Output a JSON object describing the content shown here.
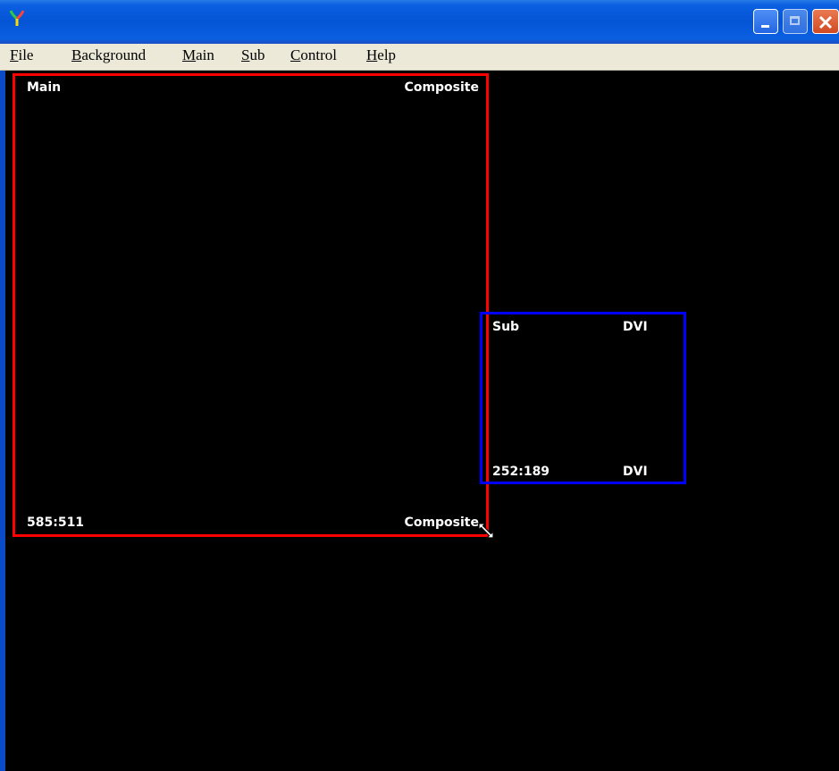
{
  "menu": {
    "items": [
      {
        "accel": "F",
        "rest": "ile"
      },
      {
        "accel": "B",
        "rest": "ackground"
      },
      {
        "accel": "M",
        "rest": "ain"
      },
      {
        "accel": "S",
        "rest": "ub"
      },
      {
        "accel": "C",
        "rest": "ontrol"
      },
      {
        "accel": "H",
        "rest": "elp"
      }
    ]
  },
  "main_window": {
    "name": "Main",
    "source_top": "Composite",
    "size": "585:511",
    "source_bottom": "Composite",
    "border_color": "#ff0000"
  },
  "sub_window": {
    "name": "Sub",
    "source_top": "DVI",
    "size": "252:189",
    "source_bottom": "DVI",
    "border_color": "#0000ff"
  },
  "icons": {
    "app": "app-icon",
    "minimize": "minimize-icon",
    "maximize": "maximize-icon",
    "close": "close-icon",
    "cursor": "resize-cursor-icon"
  }
}
